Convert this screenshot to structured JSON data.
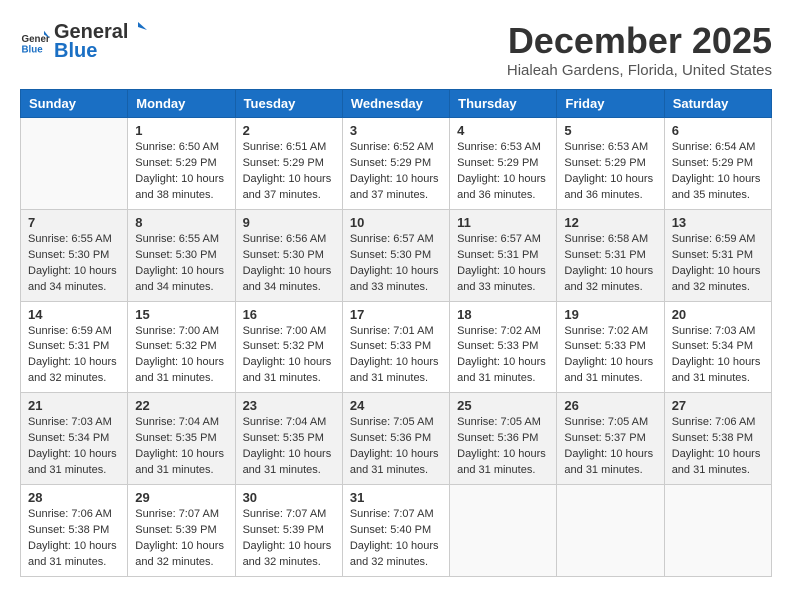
{
  "header": {
    "logo_general": "General",
    "logo_blue": "Blue",
    "month_year": "December 2025",
    "location": "Hialeah Gardens, Florida, United States"
  },
  "days_of_week": [
    "Sunday",
    "Monday",
    "Tuesday",
    "Wednesday",
    "Thursday",
    "Friday",
    "Saturday"
  ],
  "weeks": [
    [
      {
        "day": "",
        "info": ""
      },
      {
        "day": "1",
        "info": "Sunrise: 6:50 AM\nSunset: 5:29 PM\nDaylight: 10 hours\nand 38 minutes."
      },
      {
        "day": "2",
        "info": "Sunrise: 6:51 AM\nSunset: 5:29 PM\nDaylight: 10 hours\nand 37 minutes."
      },
      {
        "day": "3",
        "info": "Sunrise: 6:52 AM\nSunset: 5:29 PM\nDaylight: 10 hours\nand 37 minutes."
      },
      {
        "day": "4",
        "info": "Sunrise: 6:53 AM\nSunset: 5:29 PM\nDaylight: 10 hours\nand 36 minutes."
      },
      {
        "day": "5",
        "info": "Sunrise: 6:53 AM\nSunset: 5:29 PM\nDaylight: 10 hours\nand 36 minutes."
      },
      {
        "day": "6",
        "info": "Sunrise: 6:54 AM\nSunset: 5:29 PM\nDaylight: 10 hours\nand 35 minutes."
      }
    ],
    [
      {
        "day": "7",
        "info": "Sunrise: 6:55 AM\nSunset: 5:30 PM\nDaylight: 10 hours\nand 34 minutes."
      },
      {
        "day": "8",
        "info": "Sunrise: 6:55 AM\nSunset: 5:30 PM\nDaylight: 10 hours\nand 34 minutes."
      },
      {
        "day": "9",
        "info": "Sunrise: 6:56 AM\nSunset: 5:30 PM\nDaylight: 10 hours\nand 34 minutes."
      },
      {
        "day": "10",
        "info": "Sunrise: 6:57 AM\nSunset: 5:30 PM\nDaylight: 10 hours\nand 33 minutes."
      },
      {
        "day": "11",
        "info": "Sunrise: 6:57 AM\nSunset: 5:31 PM\nDaylight: 10 hours\nand 33 minutes."
      },
      {
        "day": "12",
        "info": "Sunrise: 6:58 AM\nSunset: 5:31 PM\nDaylight: 10 hours\nand 32 minutes."
      },
      {
        "day": "13",
        "info": "Sunrise: 6:59 AM\nSunset: 5:31 PM\nDaylight: 10 hours\nand 32 minutes."
      }
    ],
    [
      {
        "day": "14",
        "info": "Sunrise: 6:59 AM\nSunset: 5:31 PM\nDaylight: 10 hours\nand 32 minutes."
      },
      {
        "day": "15",
        "info": "Sunrise: 7:00 AM\nSunset: 5:32 PM\nDaylight: 10 hours\nand 31 minutes."
      },
      {
        "day": "16",
        "info": "Sunrise: 7:00 AM\nSunset: 5:32 PM\nDaylight: 10 hours\nand 31 minutes."
      },
      {
        "day": "17",
        "info": "Sunrise: 7:01 AM\nSunset: 5:33 PM\nDaylight: 10 hours\nand 31 minutes."
      },
      {
        "day": "18",
        "info": "Sunrise: 7:02 AM\nSunset: 5:33 PM\nDaylight: 10 hours\nand 31 minutes."
      },
      {
        "day": "19",
        "info": "Sunrise: 7:02 AM\nSunset: 5:33 PM\nDaylight: 10 hours\nand 31 minutes."
      },
      {
        "day": "20",
        "info": "Sunrise: 7:03 AM\nSunset: 5:34 PM\nDaylight: 10 hours\nand 31 minutes."
      }
    ],
    [
      {
        "day": "21",
        "info": "Sunrise: 7:03 AM\nSunset: 5:34 PM\nDaylight: 10 hours\nand 31 minutes."
      },
      {
        "day": "22",
        "info": "Sunrise: 7:04 AM\nSunset: 5:35 PM\nDaylight: 10 hours\nand 31 minutes."
      },
      {
        "day": "23",
        "info": "Sunrise: 7:04 AM\nSunset: 5:35 PM\nDaylight: 10 hours\nand 31 minutes."
      },
      {
        "day": "24",
        "info": "Sunrise: 7:05 AM\nSunset: 5:36 PM\nDaylight: 10 hours\nand 31 minutes."
      },
      {
        "day": "25",
        "info": "Sunrise: 7:05 AM\nSunset: 5:36 PM\nDaylight: 10 hours\nand 31 minutes."
      },
      {
        "day": "26",
        "info": "Sunrise: 7:05 AM\nSunset: 5:37 PM\nDaylight: 10 hours\nand 31 minutes."
      },
      {
        "day": "27",
        "info": "Sunrise: 7:06 AM\nSunset: 5:38 PM\nDaylight: 10 hours\nand 31 minutes."
      }
    ],
    [
      {
        "day": "28",
        "info": "Sunrise: 7:06 AM\nSunset: 5:38 PM\nDaylight: 10 hours\nand 31 minutes."
      },
      {
        "day": "29",
        "info": "Sunrise: 7:07 AM\nSunset: 5:39 PM\nDaylight: 10 hours\nand 32 minutes."
      },
      {
        "day": "30",
        "info": "Sunrise: 7:07 AM\nSunset: 5:39 PM\nDaylight: 10 hours\nand 32 minutes."
      },
      {
        "day": "31",
        "info": "Sunrise: 7:07 AM\nSunset: 5:40 PM\nDaylight: 10 hours\nand 32 minutes."
      },
      {
        "day": "",
        "info": ""
      },
      {
        "day": "",
        "info": ""
      },
      {
        "day": "",
        "info": ""
      }
    ]
  ]
}
